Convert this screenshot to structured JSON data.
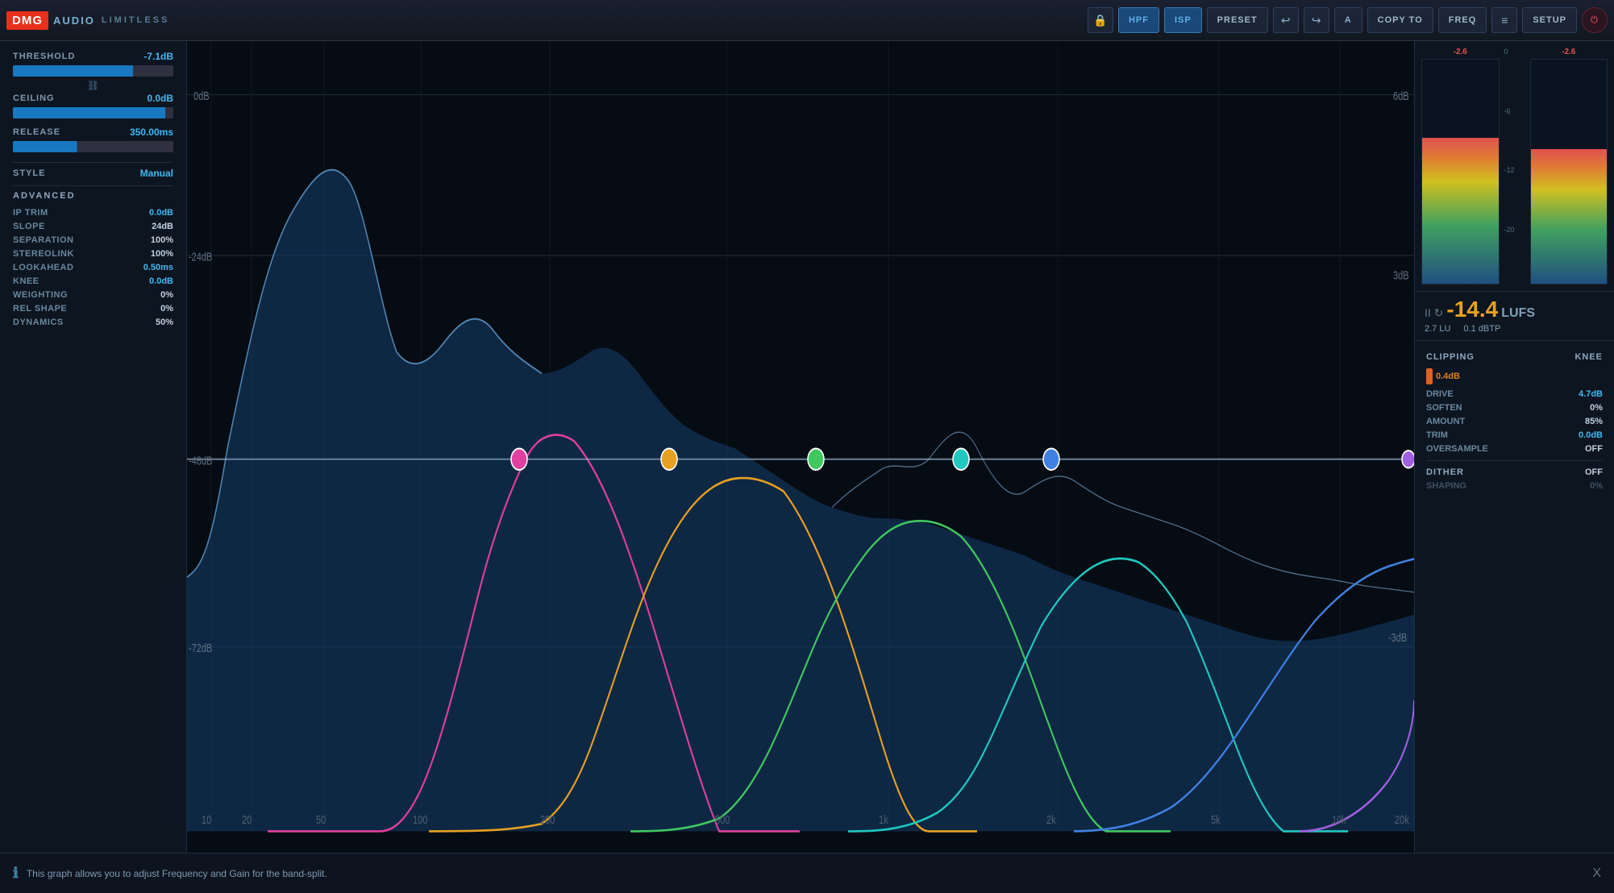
{
  "app": {
    "logo_dmg": "DMG",
    "logo_audio": "AUDIO",
    "logo_limitless": "LIMITLESS"
  },
  "topbar": {
    "lock_label": "🔒",
    "hpf_label": "HPF",
    "isp_label": "ISP",
    "preset_label": "PRESET",
    "undo_label": "↩",
    "redo_label": "↪",
    "a_label": "A",
    "copyto_label": "COPY TO",
    "freq_label": "FREQ",
    "bars_label": "≡",
    "setup_label": "SETUP",
    "power_label": "⏻"
  },
  "controls": {
    "threshold_label": "THRESHOLD",
    "threshold_value": "-7.1dB",
    "ceiling_label": "CEILING",
    "ceiling_value": "0.0dB",
    "release_label": "RELEASE",
    "release_value": "350.00ms",
    "style_label": "STYLE",
    "style_value": "Manual"
  },
  "advanced": {
    "header": "ADVANCED",
    "ip_trim_label": "IP TRIM",
    "ip_trim_value": "0.0dB",
    "slope_label": "SLOPE",
    "slope_value": "24dB",
    "separation_label": "SEPARATION",
    "separation_value": "100%",
    "stereolink_label": "STEREOLINK",
    "stereolink_value": "100%",
    "lookahead_label": "LOOKAHEAD",
    "lookahead_value": "0.50ms",
    "knee_label": "KNEE",
    "knee_value": "0.0dB",
    "weighting_label": "WEIGHTING",
    "weighting_value": "0%",
    "rel_shape_label": "REL SHAPE",
    "rel_shape_value": "0%",
    "dynamics_label": "DYNAMICS",
    "dynamics_value": "50%"
  },
  "graph": {
    "db_labels": [
      "0dB",
      "-24dB",
      "-48dB",
      "-72dB"
    ],
    "db_right_labels": [
      "6dB",
      "3dB",
      "-3dB"
    ],
    "freq_labels": [
      "10",
      "20",
      "50",
      "100",
      "200",
      "500",
      "1k",
      "2k",
      "5k",
      "10k",
      "20k"
    ]
  },
  "meters": {
    "left_peak": "-2.6",
    "right_peak": "-2.6",
    "scale_labels": [
      "0",
      "-6",
      "-12",
      "-20"
    ]
  },
  "lufs": {
    "value": "-14.4",
    "unit": "LUFS",
    "lu_value": "2.7",
    "lu_label": "LU",
    "dbtp_value": "0.1",
    "dbtp_label": "dBTP"
  },
  "right_params": {
    "clipping_label": "CLIPPING",
    "knee_label": "KNEE",
    "clipping_indicator_value": "0.4dB",
    "drive_label": "DRIVE",
    "drive_value": "4.7dB",
    "soften_label": "SOFTEN",
    "soften_value": "0%",
    "amount_label": "AMOUNT",
    "amount_value": "85%",
    "trim_label": "TRIM",
    "trim_value": "0.0dB",
    "oversample_label": "OVERSAMPLE",
    "oversample_value": "OFF",
    "dither_label": "DITHER",
    "dither_value": "OFF",
    "shaping_label": "SHAPING",
    "shaping_value": "0%"
  },
  "bottom_bar": {
    "info_text": "This graph allows you to adjust Frequency and Gain for the band-split.",
    "close_label": "X"
  }
}
